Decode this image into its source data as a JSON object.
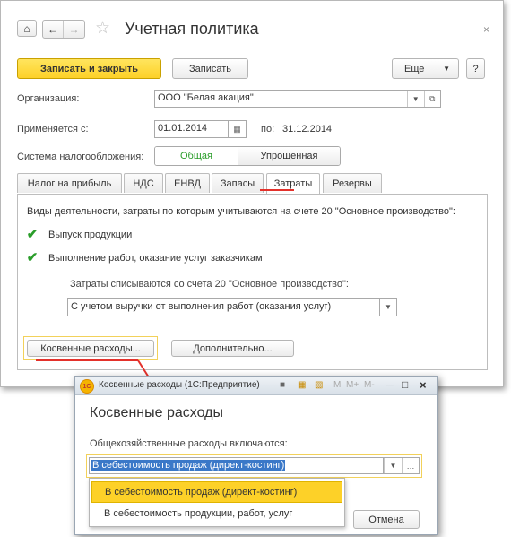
{
  "main_window": {
    "title": "Учетная политика",
    "toolbar": {
      "save_close": "Записать и закрыть",
      "save": "Записать",
      "more": "Еще",
      "help": "?"
    },
    "organization": {
      "label": "Организация:",
      "value": "ООО \"Белая акация\""
    },
    "applies": {
      "label": "Применяется с:",
      "from": "01.01.2014",
      "to_label": "по:",
      "to": "31.12.2014"
    },
    "tax_system": {
      "label": "Система налогообложения:",
      "options": [
        "Общая",
        "Упрощенная"
      ],
      "selected": "Общая"
    },
    "tabs": [
      "Налог на прибыль",
      "НДС",
      "ЕНВД",
      "Запасы",
      "Затраты",
      "Резервы"
    ],
    "active_tab": "Затраты",
    "costs": {
      "intro": "Виды деятельности, затраты по которым учитываются на счете 20 \"Основное производство\":",
      "check1": "Выпуск продукции",
      "check2": "Выполнение работ, оказание услуг заказчикам",
      "writeoff_label": "Затраты списываются со счета 20 \"Основное производство\":",
      "writeoff_value": "С учетом выручки от выполнения работ (оказания услуг)",
      "indirect_btn": "Косвенные расходы...",
      "extra_btn": "Дополнительно..."
    }
  },
  "popup": {
    "window_title": "Косвенные расходы (1С:Предприятие)",
    "title_icons": [
      "M",
      "M+",
      "M-"
    ],
    "heading": "Косвенные расходы",
    "field_label": "Общехозяйственные расходы включаются:",
    "field_value": "В себестоимость продаж (директ-костинг)",
    "options": [
      "В себестоимость продаж (директ-костинг)",
      "В себестоимость продукции, работ, услуг"
    ],
    "cancel": "Отмена"
  },
  "colors": {
    "accent_yellow": "#fdd128",
    "underline_red": "#e4312b",
    "check_green": "#2a9d2a",
    "selection_blue": "#3a78c8"
  }
}
